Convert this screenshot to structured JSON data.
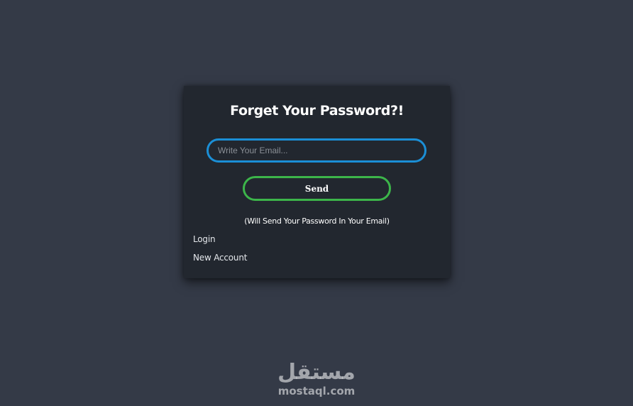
{
  "form": {
    "title": "Forget Your Password?!",
    "email_placeholder": "Write Your Email...",
    "email_value": "",
    "send_label": "Send",
    "note": "(Will Send Your Password In Your Email)"
  },
  "links": {
    "login": "Login",
    "new_account": "New Account"
  },
  "watermark": {
    "arabic": "مستقل",
    "latin": "mostaql.com"
  },
  "colors": {
    "background": "#343a47",
    "card": "#22272f",
    "input_border": "#1b8fd6",
    "button_border": "#3cb54a",
    "text": "#ffffff"
  }
}
